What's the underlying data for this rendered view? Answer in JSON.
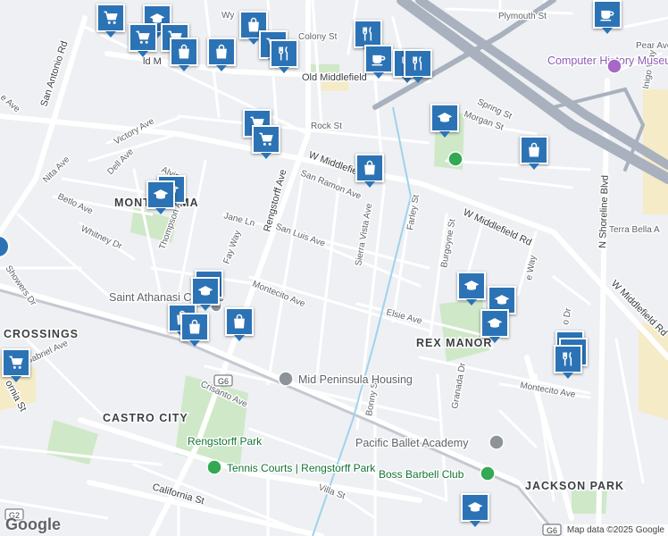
{
  "map": {
    "attribution": "Map data ©2025 Google",
    "brand": "Google",
    "colors": {
      "pin": "#2c73b5",
      "park": "#cfe8c8",
      "highway": "#a8b1bd",
      "road": "#ffffff",
      "poi_green": "#137333"
    },
    "areas": {
      "monta_loma": "MONTA LOMA",
      "crossings": "CROSSINGS",
      "rex_manor": "REX MANOR",
      "castro_city": "CASTRO CITY",
      "jackson_park": "JACKSON PARK"
    },
    "streets": {
      "wyandotte": "Wy",
      "plymouth": "Plymouth St",
      "colony": "Colony St",
      "old_middlefield": "Old Middlefield",
      "old_middlefield_left": "ld M",
      "pear": "Pear Ave",
      "inigo": "Inigo Way",
      "san_antonio": "San Antonio Rd",
      "spring": "Spring St",
      "morgan": "Morgan St",
      "rock": "Rock St",
      "victory": "Victory Ave",
      "dell": "Dell Ave",
      "nita": "Nita Ave",
      "betlo": "Betlo Ave",
      "alvin": "Alvin",
      "w_middlefield": "W Middlefield",
      "w_middlefield_rd": "W Middlefield Rd",
      "w_middlefield_rd_east": "W Middlefield Rd",
      "san_ramon": "San Ramon Ave",
      "rengstorff": "Rengstorff Ave",
      "jane": "Jane Ln",
      "thompson": "Thompson Ave",
      "fay": "Fay Way",
      "whitney": "Whitney Dr",
      "san_luis": "San Luis Ave",
      "sierra_vista": "Sierra Vista Ave",
      "farley": "Farley St",
      "burgoyne": "Burgoyne St",
      "terra_bella": "Terra Bella A",
      "n_shoreline": "N Shoreline Blvd",
      "montecito": "Montecito Ave",
      "montecito_east": "Montecito Ave",
      "elsie": "Elsie Ave",
      "showers": "Showers Dr",
      "gabriel": "Gabriel Ave",
      "california": "California St",
      "california_left": "ornia St",
      "crisanto": "Crisanto Ave",
      "bonny": "Bonny St",
      "granada": "Granada Dr",
      "villa": "Villa St",
      "way_right": "e Way",
      "dr_right": "o Dr",
      "ave_left": "e Ave",
      "g6": "G6",
      "g6_b": "G6",
      "g2": "G2"
    },
    "places": {
      "computer_history": "Computer History Museum",
      "saint_athanasius": "Saint Athanasi Catholic",
      "mid_peninsula": "Mid Peninsula Housing",
      "rengstorff_park": "Rengstorff Park",
      "tennis_courts": "Tennis Courts | Rengstorff Park",
      "pacific_ballet": "Pacific Ballet Academy",
      "boss_barbell": "Boss Barbell Club"
    }
  }
}
